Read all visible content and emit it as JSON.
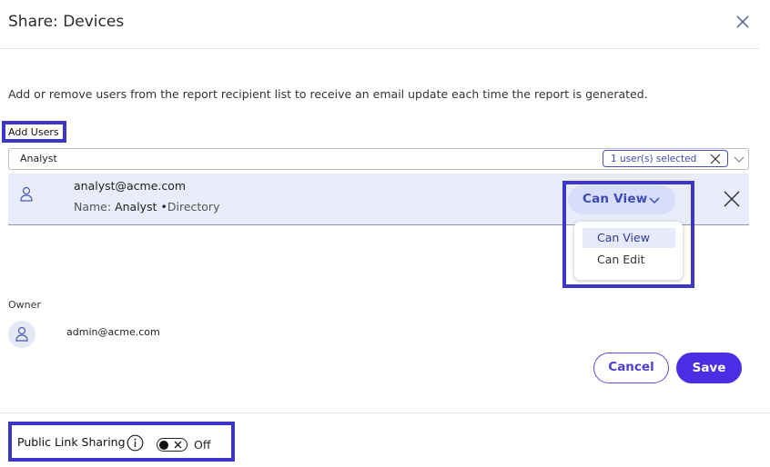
{
  "dialog": {
    "title": "Share: Devices",
    "instructions": "Add or remove users from the report recipient list to receive an email update each time the report is generated."
  },
  "add_users": {
    "label": "Add Users",
    "search_value": "Analyst",
    "selected_badge": "1 user(s) selected"
  },
  "user_row": {
    "email": "analyst@acme.com",
    "name_prefix": "Name:",
    "name": "Analyst",
    "bullet": "•",
    "source": "Directory"
  },
  "permission": {
    "current": "Can View",
    "options": [
      "Can View",
      "Can Edit"
    ]
  },
  "owner": {
    "label": "Owner",
    "email": "admin@acme.com"
  },
  "actions": {
    "cancel": "Cancel",
    "save": "Save"
  },
  "public_link": {
    "label": "Public Link Sharing",
    "state_text": "Off"
  },
  "colors": {
    "primary": "#4b2ee3",
    "highlight_box": "#3b35c8",
    "row_bg": "#e9edfb",
    "pill_bg": "#d7defa"
  },
  "icons": [
    "close-icon",
    "clear-selection-icon",
    "chevron-down-icon",
    "user-icon",
    "remove-user-icon",
    "info-icon",
    "toggle-off-icon"
  ]
}
